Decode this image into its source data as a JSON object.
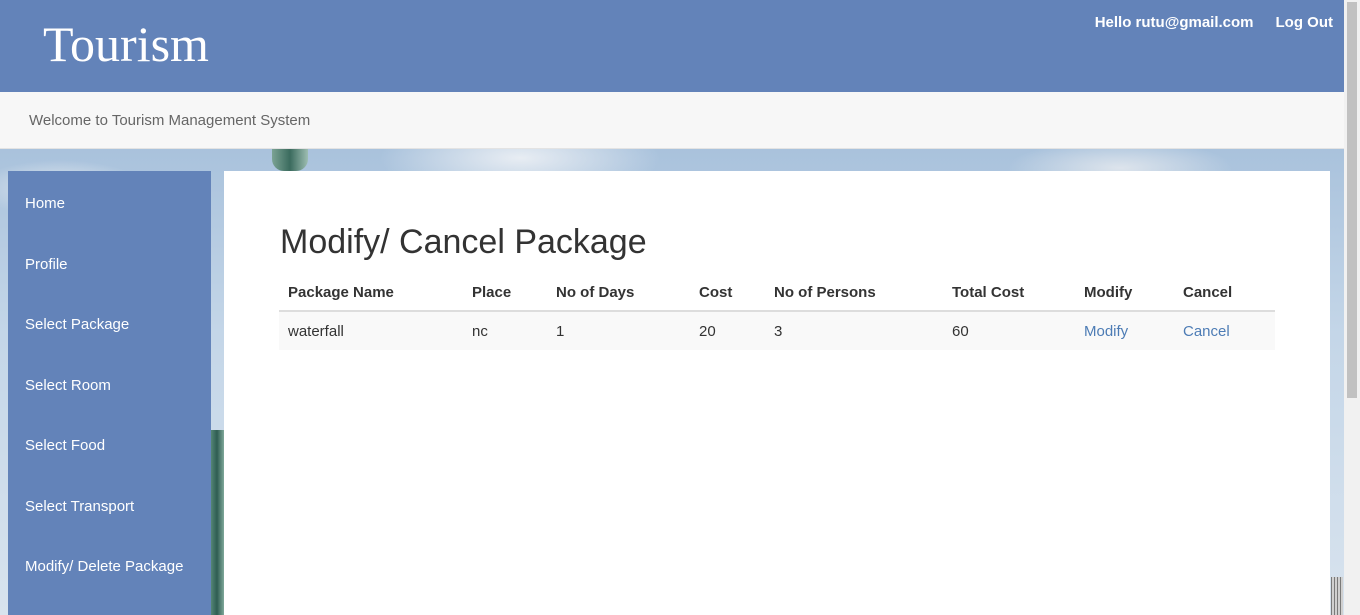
{
  "header": {
    "brand": "Tourism",
    "greeting": "Hello rutu@gmail.com",
    "logout_label": "Log Out"
  },
  "welcome": {
    "text": "Welcome to Tourism Management System"
  },
  "sidebar": {
    "items": [
      {
        "label": "Home"
      },
      {
        "label": "Profile"
      },
      {
        "label": "Select Package"
      },
      {
        "label": "Select Room"
      },
      {
        "label": "Select Food"
      },
      {
        "label": "Select Transport"
      },
      {
        "label": "Modify/ Delete Package"
      }
    ]
  },
  "main": {
    "title": "Modify/ Cancel Package",
    "columns": [
      "Package Name",
      "Place",
      "No of Days",
      "Cost",
      "No of Persons",
      "Total Cost",
      "Modify",
      "Cancel"
    ],
    "rows": [
      {
        "package_name": "waterfall",
        "place": "nc",
        "days": "1",
        "cost": "20",
        "persons": "3",
        "total_cost": "60",
        "modify_label": "Modify",
        "cancel_label": "Cancel"
      }
    ]
  },
  "colors": {
    "brand_blue": "#6383b9",
    "link_blue": "#4d7cb5"
  }
}
